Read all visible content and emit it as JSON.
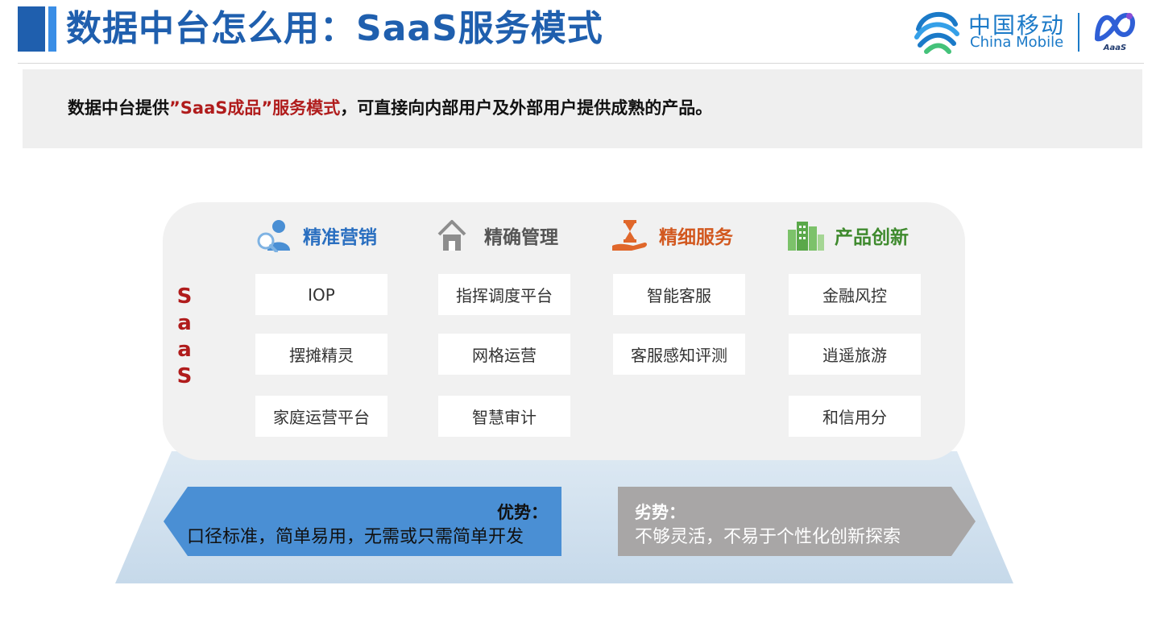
{
  "header": {
    "title": "数据中台怎么用：SaaS服务模式",
    "logo_cn": "中国移动",
    "logo_en": "China Mobile",
    "secondary_logo_text": "AaaS"
  },
  "intro": {
    "prefix": "数据中台提供",
    "highlight": "”SaaS成品”服务模式",
    "suffix": "，可直接向内部用户及外部用户提供成熟的产品。"
  },
  "saas_label": [
    "S",
    "a",
    "a",
    "S"
  ],
  "columns": [
    {
      "title": "精准营销",
      "icon": "user-search-icon",
      "color": "#2a6fc0",
      "items": [
        "IOP",
        "摆摊精灵",
        "家庭运营平台"
      ]
    },
    {
      "title": "精确管理",
      "icon": "house-icon",
      "color": "#555555",
      "items": [
        "指挥调度平台",
        "网格运营",
        "智慧审计"
      ]
    },
    {
      "title": "精细服务",
      "icon": "service-hand-icon",
      "color": "#d2581f",
      "items": [
        "智能客服",
        "客服感知评测"
      ]
    },
    {
      "title": "产品创新",
      "icon": "buildings-icon",
      "color": "#3f8a2e",
      "items": [
        "金融风控",
        "逍遥旅游",
        "和信用分"
      ]
    }
  ],
  "advantages": {
    "title": "优势：",
    "text": "口径标准，简单易用，无需或只需简单开发"
  },
  "disadvantages": {
    "title": "劣势：",
    "text": "不够灵活，不易于个性化创新探索"
  },
  "colors": {
    "title_blue": "#1f5fae",
    "brand_blue": "#1b7ac8",
    "highlight_red": "#b01c1c",
    "advantage_blue": "#4a8fd4",
    "disadvantage_gray": "#a8a6a6"
  }
}
